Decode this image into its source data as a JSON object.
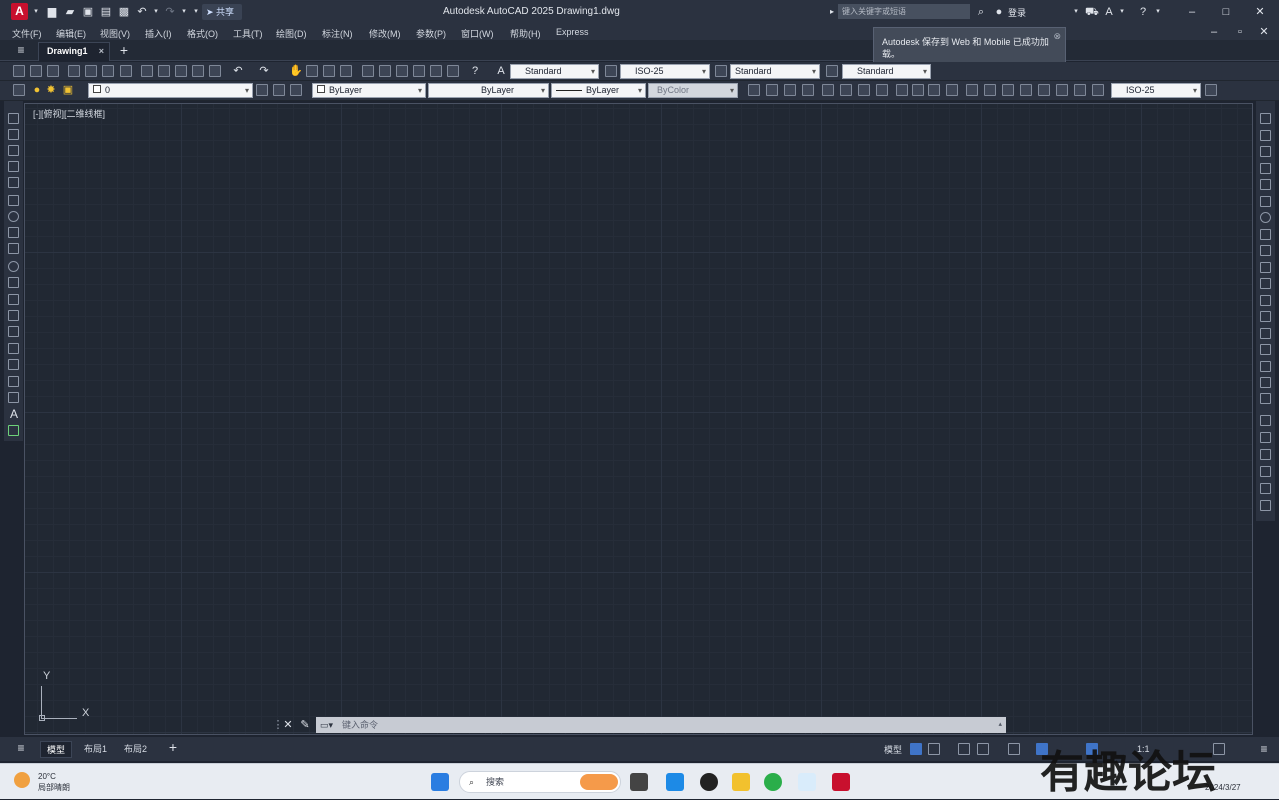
{
  "titlebar": {
    "logo": "A",
    "share_label": "共享",
    "title": "Autodesk AutoCAD 2025   Drawing1.dwg",
    "search_placeholder": "键入关键字或短语",
    "signin": "登录"
  },
  "menu": {
    "items": [
      "文件(F)",
      "编辑(E)",
      "视图(V)",
      "插入(I)",
      "格式(O)",
      "工具(T)",
      "绘图(D)",
      "标注(N)",
      "修改(M)",
      "参数(P)",
      "窗口(W)",
      "帮助(H)",
      "Express"
    ]
  },
  "tabs": {
    "doc_tab": "Drawing1",
    "close": "×",
    "add": "+"
  },
  "notification": {
    "text": "Autodesk 保存到 Web 和 Mobile 已成功加载。"
  },
  "toolbar1": {
    "text_style": "Standard",
    "dim_style": "ISO-25",
    "table_style": "Standard",
    "multileader_style": "Standard"
  },
  "toolbar2": {
    "layer": "0",
    "color": "ByLayer",
    "linetype": "ByLayer",
    "lineweight": "ByLayer",
    "plotstyle": "ByColor",
    "dim_style": "ISO-25"
  },
  "canvas": {
    "viewport_label": "[-][俯视][二维线框]",
    "ucs_x": "X",
    "ucs_y": "Y"
  },
  "command": {
    "placeholder": "键入命令"
  },
  "layouts": {
    "tabs": [
      "模型",
      "布局1",
      "布局2"
    ],
    "model_btn": "模型",
    "scale": "1:1"
  },
  "taskbar": {
    "temperature": "20°C",
    "weather": "局部晴朗",
    "search": "搜索",
    "date": "2024/3/27"
  },
  "watermark": "有趣论坛"
}
